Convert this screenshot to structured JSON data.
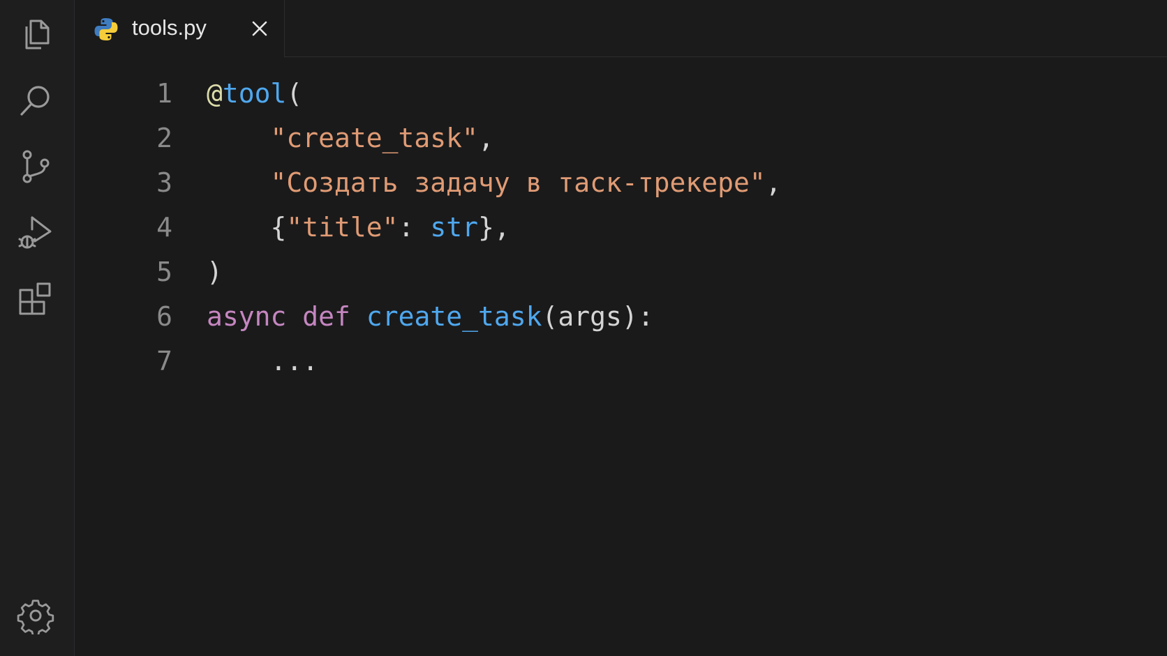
{
  "activity_bar": {
    "icons": [
      "files-icon",
      "search-icon",
      "source-control-icon",
      "run-debug-icon",
      "extensions-icon"
    ],
    "bottom_icon": "gear-icon"
  },
  "tab": {
    "label": "tools.py",
    "file_icon": "python-icon",
    "close_icon": "close-icon"
  },
  "editor": {
    "lines": [
      {
        "number": "1",
        "tokens": [
          {
            "text": "@",
            "kind": "deco"
          },
          {
            "text": "tool",
            "kind": "fn"
          },
          {
            "text": "(",
            "kind": "plain"
          }
        ]
      },
      {
        "number": "2",
        "tokens": [
          {
            "text": "    ",
            "kind": "plain"
          },
          {
            "text": "\"create_task\"",
            "kind": "str"
          },
          {
            "text": ",",
            "kind": "plain"
          }
        ]
      },
      {
        "number": "3",
        "tokens": [
          {
            "text": "    ",
            "kind": "plain"
          },
          {
            "text": "\"Создать задачу в таск-трекере\"",
            "kind": "str"
          },
          {
            "text": ",",
            "kind": "plain"
          }
        ]
      },
      {
        "number": "4",
        "tokens": [
          {
            "text": "    {",
            "kind": "plain"
          },
          {
            "text": "\"title\"",
            "kind": "str"
          },
          {
            "text": ": ",
            "kind": "plain"
          },
          {
            "text": "str",
            "kind": "type"
          },
          {
            "text": "},",
            "kind": "plain"
          }
        ]
      },
      {
        "number": "5",
        "tokens": [
          {
            "text": ")",
            "kind": "plain"
          }
        ]
      },
      {
        "number": "6",
        "tokens": [
          {
            "text": "async",
            "kind": "kw"
          },
          {
            "text": " ",
            "kind": "plain"
          },
          {
            "text": "def",
            "kind": "kw"
          },
          {
            "text": " ",
            "kind": "plain"
          },
          {
            "text": "create_task",
            "kind": "fn"
          },
          {
            "text": "(args):",
            "kind": "plain"
          }
        ]
      },
      {
        "number": "7",
        "tokens": [
          {
            "text": "    ...",
            "kind": "plain"
          }
        ]
      }
    ]
  },
  "colors": {
    "background": "#1a1a1b",
    "decorator": "#dcdcaa",
    "function": "#4fa8ee",
    "string": "#e09b74",
    "keyword": "#c586c0",
    "line_number": "#8a8a8a",
    "plain": "#d4d4d4"
  }
}
